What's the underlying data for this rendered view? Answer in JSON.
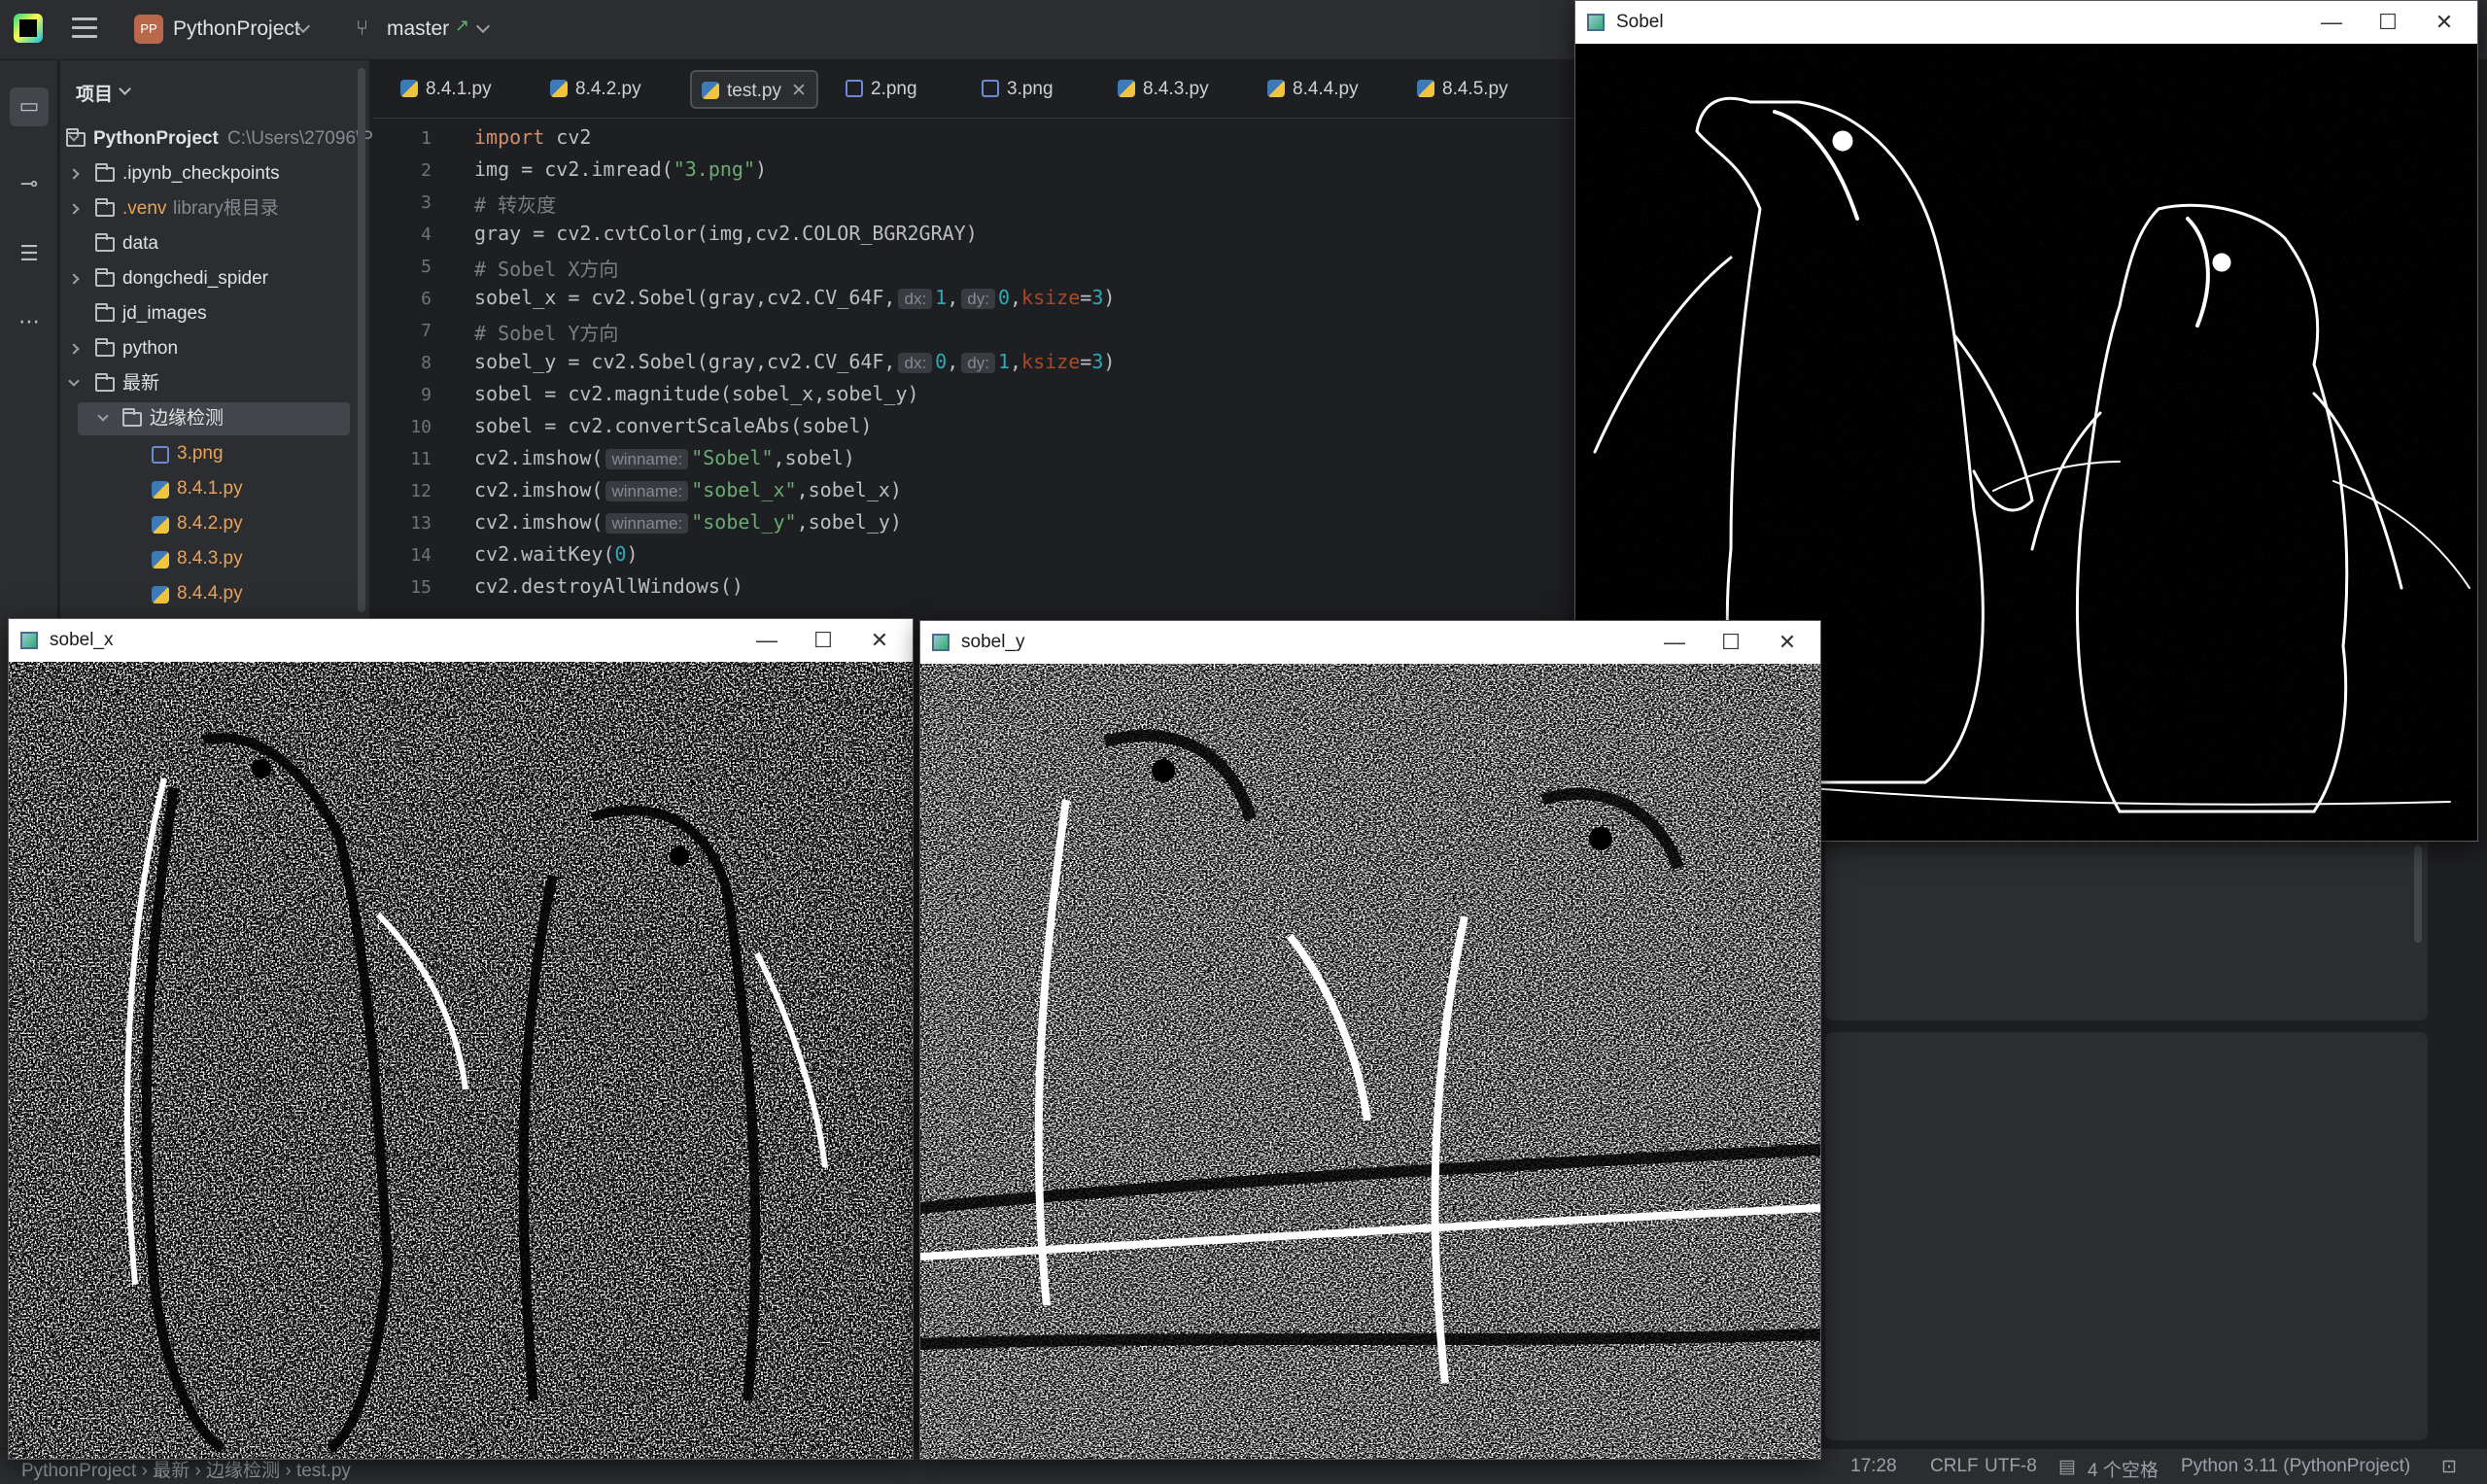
{
  "ide": {
    "project_badge": "PP",
    "project_name": "PythonProject",
    "branch": "master",
    "branch_arrow": "↗"
  },
  "project_panel": {
    "title": "项目",
    "tree": [
      {
        "label": "PythonProject",
        "hint": "C:\\Users\\27096\\P",
        "type": "folder",
        "expanded": true
      },
      {
        "label": ".ipynb_checkpoints",
        "type": "folder"
      },
      {
        "label": ".venv",
        "hint": "library根目录",
        "type": "folder"
      },
      {
        "label": "data",
        "type": "folder"
      },
      {
        "label": "dongchedi_spider",
        "type": "folder"
      },
      {
        "label": "jd_images",
        "type": "folder"
      },
      {
        "label": "python",
        "type": "folder"
      },
      {
        "label": "最新",
        "type": "folder",
        "expanded": true
      },
      {
        "label": "边缘检测",
        "type": "folder",
        "expanded": true,
        "selected": true
      },
      {
        "label": "3.png",
        "type": "png"
      },
      {
        "label": "8.4.1.py",
        "type": "py"
      },
      {
        "label": "8.4.2.py",
        "type": "py"
      },
      {
        "label": "8.4.3.py",
        "type": "py"
      },
      {
        "label": "8.4.4.py",
        "type": "py"
      }
    ]
  },
  "tabs": [
    {
      "label": "8.4.1.py",
      "type": "py"
    },
    {
      "label": "8.4.2.py",
      "type": "py"
    },
    {
      "label": "test.py",
      "type": "py",
      "active": true
    },
    {
      "label": "2.png",
      "type": "png"
    },
    {
      "label": "3.png",
      "type": "png"
    },
    {
      "label": "8.4.3.py",
      "type": "py"
    },
    {
      "label": "8.4.4.py",
      "type": "py"
    },
    {
      "label": "8.4.5.py",
      "type": "py"
    }
  ],
  "code": {
    "line_numbers": [
      "1",
      "2",
      "3",
      "4",
      "5",
      "6",
      "7",
      "8",
      "9",
      "10",
      "11",
      "12",
      "13",
      "14",
      "15"
    ],
    "l1_kw": "import",
    "l1_rest": " cv2",
    "l2_a": "img = cv2.imread(",
    "l2_str": "\"3.png\"",
    "l2_b": ")",
    "l3": "# 转灰度",
    "l4": "gray = cv2.cvtColor(img,cv2.COLOR_BGR2GRAY)",
    "l5": "# Sobel X方向",
    "l6_a": "sobel_x = cv2.Sobel(gray,cv2.CV_64F,",
    "l6_h1": "dx:",
    "l6_n1": "1",
    "l6_c1": ",",
    "l6_h2": "dy:",
    "l6_n2": "0",
    "l6_c2": ",",
    "l6_k": "ksize",
    "l6_eq": "=",
    "l6_n3": "3",
    "l6_end": ")",
    "l7": "# Sobel Y方向",
    "l8_a": "sobel_y = cv2.Sobel(gray,cv2.CV_64F,",
    "l8_h1": "dx:",
    "l8_n1": "0",
    "l8_c1": ",",
    "l8_h2": "dy:",
    "l8_n2": "1",
    "l8_c2": ",",
    "l8_k": "ksize",
    "l8_eq": "=",
    "l8_n3": "3",
    "l8_end": ")",
    "l9": "sobel = cv2.magnitude(sobel_x,sobel_y)",
    "l10": "sobel = cv2.convertScaleAbs(sobel)",
    "l11_a": "cv2.imshow(",
    "l11_h": "winname:",
    "l11_s": "\"Sobel\"",
    "l11_b": ",sobel)",
    "l12_a": "cv2.imshow(",
    "l12_h": "winname:",
    "l12_s": "\"sobel_x\"",
    "l12_b": ",sobel_x)",
    "l13_a": "cv2.imshow(",
    "l13_h": "winname:",
    "l13_s": "\"sobel_y\"",
    "l13_b": ",sobel_y)",
    "l14_a": "cv2.waitKey(",
    "l14_n": "0",
    "l14_b": ")",
    "l15": "cv2.destroyAllWindows()"
  },
  "windows": {
    "sobel": {
      "title": "Sobel",
      "min": "—",
      "max": "☐",
      "close": "✕"
    },
    "sobel_x": {
      "title": "sobel_x",
      "min": "—",
      "max": "☐",
      "close": "✕"
    },
    "sobel_y": {
      "title": "sobel_y",
      "min": "—",
      "max": "☐",
      "close": "✕"
    }
  },
  "statusbar": {
    "breadcrumb": "PythonProject › 最新 › 边缘检测 › test.py",
    "position": "17:28",
    "line_sep": "CRLF",
    "encoding": "UTF-8",
    "indent": "4 个空格",
    "interpreter": "Python 3.11 (PythonProject)"
  },
  "colors": {
    "ide_bg": "#1e1f22",
    "panel_bg": "#2b2d30",
    "keyword": "#cf8e6d",
    "string": "#6aab73",
    "number": "#2aacb8"
  }
}
